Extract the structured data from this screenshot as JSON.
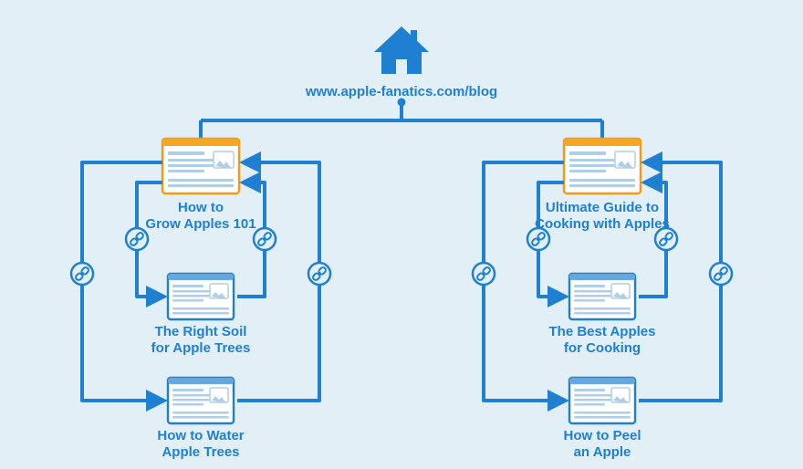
{
  "root": {
    "url": "www.apple-fanatics.com/blog"
  },
  "left_cluster": {
    "cornerstone": {
      "line1": "How to",
      "line2": "Grow Apples 101"
    },
    "sub_a": {
      "line1": "The Right Soil",
      "line2": "for Apple Trees"
    },
    "sub_b": {
      "line1": "How to Water",
      "line2": "Apple Trees"
    }
  },
  "right_cluster": {
    "cornerstone": {
      "line1": "Ultimate Guide to",
      "line2": "Cooking with Apples"
    },
    "sub_a": {
      "line1": "The Best Apples",
      "line2": "for Cooking"
    },
    "sub_b": {
      "line1": "How to Peel",
      "line2": "an Apple"
    }
  },
  "icons": {
    "home": "house-icon",
    "page": "webpage-icon",
    "link": "link-icon"
  },
  "colors": {
    "accent": "#1f80d1",
    "highlight": "#f39c12",
    "background": "#e2eff7"
  }
}
